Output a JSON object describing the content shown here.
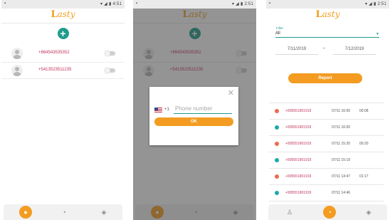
{
  "statusbar": {
    "screen1_time": "4:51",
    "screen2_time": "2:51",
    "screen3_time": "2:51"
  },
  "app": {
    "logo_initial": "L",
    "logo_rest": "asty"
  },
  "contacts": [
    {
      "number": "+864543535352"
    },
    {
      "number": "+5413523511235"
    }
  ],
  "dialog": {
    "country_code": "+1",
    "phone_placeholder": "Phone number",
    "ok_label": "OK",
    "close_label": "✕"
  },
  "report": {
    "filter_label": "Filter",
    "filter_value": "All",
    "date_from": "7/11/2019",
    "date_separator": "~",
    "date_to": "7/12/2019",
    "button_label": "Report",
    "calls": [
      {
        "number": "+905551901919",
        "date": "07/11 16:00",
        "duration": "00:08",
        "status_color": "#ef6a4f"
      },
      {
        "number": "+905551901919",
        "date": "07/11 16:00",
        "duration": "",
        "status_color": "#20a8a8"
      },
      {
        "number": "+905551901919",
        "date": "07/11 15:20",
        "duration": "00:20",
        "status_color": "#ef6a4f"
      },
      {
        "number": "+905551901919",
        "date": "07/11 15:19",
        "duration": "",
        "status_color": "#20a8a8"
      },
      {
        "number": "+905551901919",
        "date": "07/11 14:47",
        "duration": "01:17",
        "status_color": "#ef6a4f"
      },
      {
        "number": "+905551901919",
        "date": "07/11 14:46",
        "duration": "",
        "status_color": "#20a8a8"
      }
    ]
  },
  "colors": {
    "accent": "#f39c21",
    "primary": "#1e9c8c",
    "number_text": "#c0325a"
  },
  "nav": {
    "icons": [
      "person-icon",
      "call-report-icon",
      "tag-icon"
    ]
  }
}
